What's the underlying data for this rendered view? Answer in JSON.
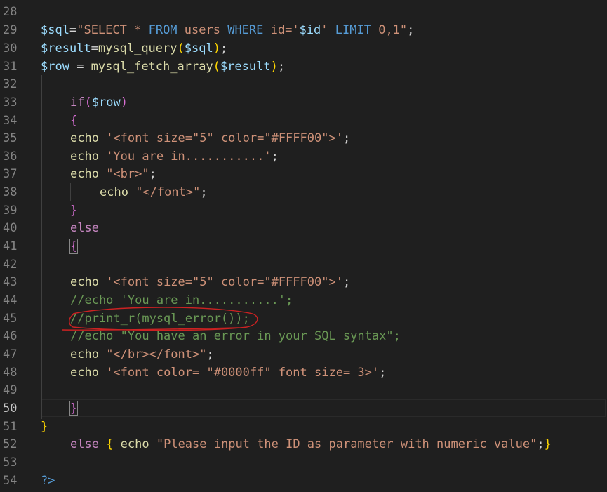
{
  "line_numbers": [
    "28",
    "29",
    "30",
    "31",
    "32",
    "33",
    "34",
    "35",
    "36",
    "37",
    "38",
    "39",
    "40",
    "41",
    "42",
    "43",
    "44",
    "45",
    "46",
    "47",
    "48",
    "49",
    "50",
    "51",
    "52",
    "53",
    "54"
  ],
  "current_line": "50",
  "code": {
    "l29": {
      "a": "$sql",
      "b": "=",
      "c": "\"",
      "d": "SELECT",
      "e": " * ",
      "f": "FROM",
      "g": " users ",
      "h": "WHERE",
      "i": " id='",
      "j": "$id",
      "k": "' ",
      "l": "LIMIT",
      "m": " 0,1\"",
      ";": ";"
    },
    "l30": {
      "a": "$result",
      "b": "=",
      "c": "mysql_query",
      "d": "(",
      "e": "$sql",
      "f": ")",
      "g": ";"
    },
    "l31": {
      "a": "$row",
      "b": " = ",
      "c": "mysql_fetch_array",
      "d": "(",
      "e": "$result",
      "f": ")",
      "g": ";"
    },
    "l33": {
      "a": "if",
      "b": "(",
      "c": "$row",
      "d": ")"
    },
    "l34": {
      "a": "{"
    },
    "l35": {
      "a": "echo ",
      "b": "'<font size=\"5\" color=\"#FFFF00\">'",
      "c": ";"
    },
    "l36": {
      "a": "echo ",
      "b": "'You are in...........'",
      "c": ";"
    },
    "l37": {
      "a": "echo ",
      "b": "\"<br>\"",
      "c": ";"
    },
    "l38": {
      "a": "echo ",
      "b": "\"</font>\"",
      "c": ";"
    },
    "l39": {
      "a": "}"
    },
    "l40": {
      "a": "else"
    },
    "l41": {
      "a": "{"
    },
    "l43": {
      "a": "echo ",
      "b": "'<font size=\"5\" color=\"#FFFF00\">'",
      "c": ";"
    },
    "l44": {
      "a": "//echo 'You are in...........';"
    },
    "l45": {
      "a": "//print_r(mysql_error());"
    },
    "l46": {
      "a": "//echo \"You have an error in your SQL syntax\";"
    },
    "l47": {
      "a": "echo ",
      "b": "\"</br></font>\"",
      "c": ";"
    },
    "l48": {
      "a": "echo ",
      "b": "'<font color= \"#0000ff\" font size= 3>'",
      "c": ";"
    },
    "l50": {
      "a": "}"
    },
    "l51": {
      "a": "}"
    },
    "l52": {
      "a": "else ",
      "b": "{",
      "c": " echo ",
      "d": "\"Please input the ID as parameter with numeric value\"",
      "e": ";",
      "f": "}"
    },
    "l54": {
      "a": "?>"
    }
  },
  "annotation": {
    "type": "red-ink-circle-and-underline",
    "target_line": "45",
    "color": "#cc2222"
  }
}
